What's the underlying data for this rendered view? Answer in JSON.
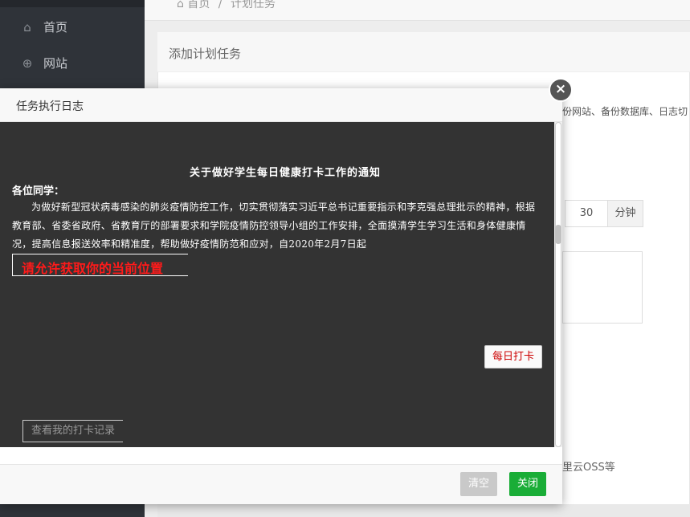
{
  "sidebar": {
    "items": [
      {
        "label": "首页",
        "icon": "home-icon"
      },
      {
        "label": "网站",
        "icon": "globe-icon"
      }
    ]
  },
  "breadcrumb": {
    "home": "首页",
    "separator": "/",
    "current": "计划任务"
  },
  "panel": {
    "title": "添加计划任务",
    "description": "备份网站、备份数据库、日志切",
    "minute_value": "30",
    "minute_unit": "分钟",
    "oss_hint": "里云OSS等"
  },
  "modal": {
    "title": "任务执行日志",
    "close_glyph": "×",
    "notice_title": "关于做好学生每日健康打卡工作的通知",
    "greeting": "各位同学：",
    "notice_body": "为做好新型冠状病毒感染的肺炎疫情防控工作，切实贯彻落实习近平总书记重要指示和李克强总理批示的精神，根据教育部、省委省政府、省教育厅的部署要求和学院疫情防控领导小组的工作安排，全面摸清学生学习生活和身体健康情况，提高信息报送效率和精准度，帮助做好疫情防范和应对，自2020年2月7日起",
    "location_prompt": "请允许获取你的当前位置",
    "punch_button": "每日打卡",
    "record_button": "查看我的打卡记录",
    "clear_button": "清空",
    "close_button": "关闭"
  },
  "colors": {
    "log_background": "#333333",
    "prompt_red": "#ff1a1a",
    "close_green": "#1aad37",
    "clear_gray": "#c9c9c9"
  }
}
